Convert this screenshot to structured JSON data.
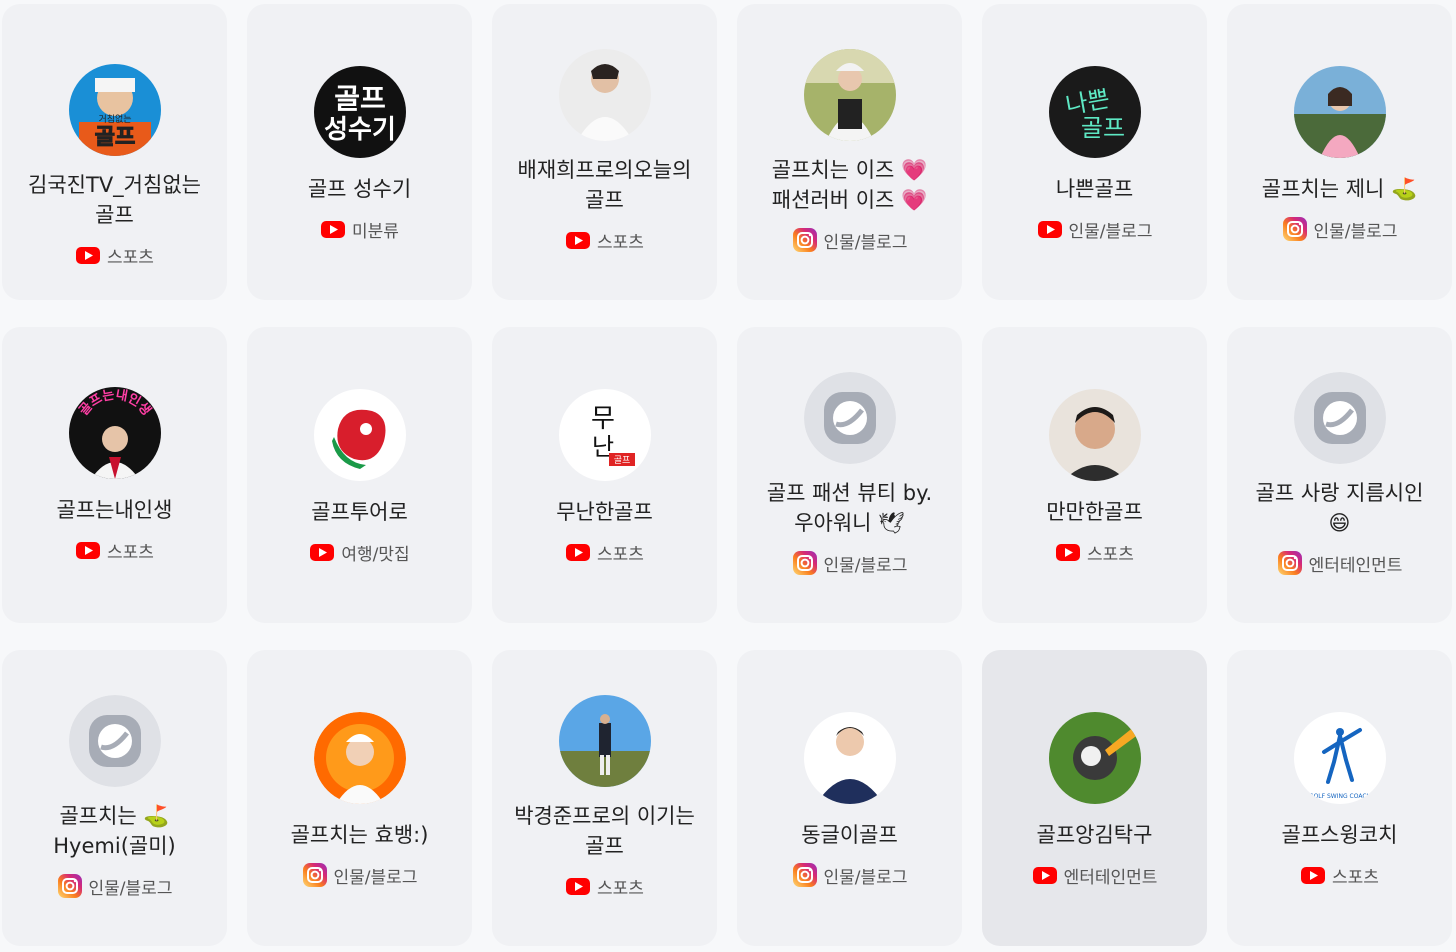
{
  "cards": [
    {
      "name": "김국진TV_거침없는 골프",
      "platform": "youtube",
      "category": "스포츠",
      "avatar_text": "골프",
      "avatar_sub": "거침없는"
    },
    {
      "name": "골프 성수기",
      "platform": "youtube",
      "category": "미분류",
      "avatar_text": "골프",
      "avatar_sub": "성수기"
    },
    {
      "name": "배재희프로의오늘의 골프",
      "platform": "youtube",
      "category": "스포츠"
    },
    {
      "name": "골프치는 이즈 💗 패션러버 이즈 💗",
      "platform": "instagram",
      "category": "인물/블로그"
    },
    {
      "name": "나쁜골프",
      "platform": "youtube",
      "category": "인물/블로그",
      "avatar_text": "나쁜",
      "avatar_sub": "골프"
    },
    {
      "name": "골프치는 제니 ⛳",
      "platform": "instagram",
      "category": "인물/블로그"
    },
    {
      "name": "골프는내인생",
      "platform": "youtube",
      "category": "스포츠",
      "avatar_text": "골프는내인생"
    },
    {
      "name": "골프투어로",
      "platform": "youtube",
      "category": "여행/맛집"
    },
    {
      "name": "무난한골프",
      "platform": "youtube",
      "category": "스포츠",
      "avatar_text": "무",
      "avatar_sub": "난",
      "avatar_tag": "골프"
    },
    {
      "name": "골프 패션 뷰티 by.우아워니 🕊",
      "platform": "instagram",
      "category": "인물/블로그"
    },
    {
      "name": "만만한골프",
      "platform": "youtube",
      "category": "스포츠"
    },
    {
      "name": "골프 사랑 지름시인 😄",
      "platform": "instagram",
      "category": "엔터테인먼트"
    },
    {
      "name": "골프치는 ⛳ Hyemi(골미)",
      "platform": "instagram",
      "category": "인물/블로그"
    },
    {
      "name": "골프치는 효뱅:)",
      "platform": "instagram",
      "category": "인물/블로그"
    },
    {
      "name": "박경준프로의 이기는 골프",
      "platform": "youtube",
      "category": "스포츠"
    },
    {
      "name": "동글이골프",
      "platform": "instagram",
      "category": "인물/블로그"
    },
    {
      "name": "골프앙김탁구",
      "platform": "youtube",
      "category": "엔터테인먼트"
    },
    {
      "name": "골프스윙코치",
      "platform": "youtube",
      "category": "스포츠",
      "avatar_text": "GOLF SWING COACH"
    }
  ],
  "colors": {
    "youtube": "#ff0000",
    "card": "#f0f1f4",
    "card_hover": "#e6e7eb"
  }
}
